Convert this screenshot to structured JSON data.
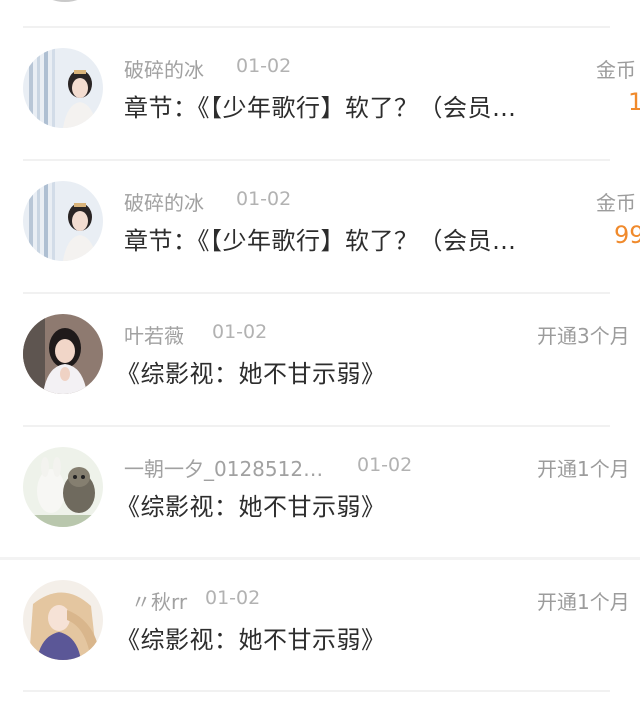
{
  "items": [
    {
      "user": "破碎的冰",
      "date": "01-02",
      "message": "章节：《【少年歌行】软了？（会员…",
      "right_label": "金币",
      "right_value": "1",
      "avatar": "ice-avatar"
    },
    {
      "user": "破碎的冰",
      "date": "01-02",
      "message": "章节：《【少年歌行】软了？（会员…",
      "right_label": "金币",
      "right_value": "99",
      "avatar": "ice-avatar"
    },
    {
      "user": "叶若薇",
      "date": "01-02",
      "message": "《综影视：她不甘示弱》",
      "right_label": "开通3个月",
      "avatar": "girl-avatar"
    },
    {
      "user": "一朝一夕_0128512…",
      "date": "01-02",
      "message": "《综影视：她不甘示弱》",
      "right_label": "开通1个月",
      "avatar": "cartoon-avatar"
    },
    {
      "user": "〃秋rr",
      "date": "01-02",
      "message": "《综影视：她不甘示弱》",
      "right_label": "开通1个月",
      "avatar": "anime-avatar"
    }
  ],
  "colors": {
    "coin_accent": "#f08a2c",
    "name_gray": "#a1a1a1",
    "message_text": "#2d2d2d"
  }
}
